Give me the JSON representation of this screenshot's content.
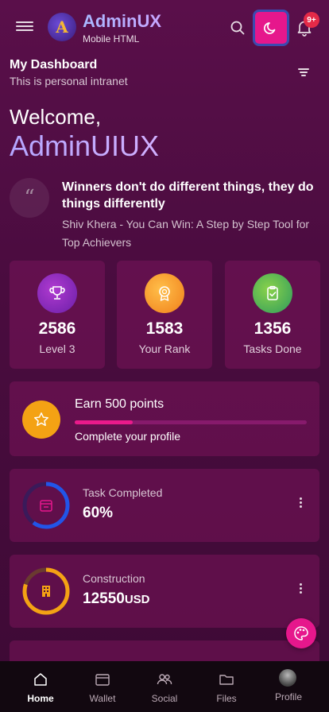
{
  "header": {
    "brand_title": "AdminUX",
    "brand_subtitle": "Mobile HTML",
    "logo_letter": "A",
    "notification_badge": "9+"
  },
  "dashboard": {
    "title": "My Dashboard",
    "subtitle": "This is personal intranet"
  },
  "welcome": {
    "greeting": "Welcome,",
    "name": "AdminUIUX"
  },
  "quote": {
    "icon_glyph": "“",
    "text": "Winners don't do different things, they do things differently",
    "author": "Shiv Khera - You Can Win: A Step by Step Tool for Top Achievers"
  },
  "stats": [
    {
      "icon": "trophy-icon",
      "value": "2586",
      "label": "Level 3",
      "color": "#8b2fc9"
    },
    {
      "icon": "medal-icon",
      "value": "1583",
      "label": "Your Rank",
      "color": "#f59a24"
    },
    {
      "icon": "clipboard-check-icon",
      "value": "1356",
      "label": "Tasks Done",
      "color": "#4caf50"
    }
  ],
  "earn": {
    "title": "Earn 500 points",
    "subtitle": "Complete your profile",
    "progress": 0.25,
    "icon": "star-icon"
  },
  "metrics": [
    {
      "label": "Task Completed",
      "value": "60%",
      "unit": "",
      "progress": 0.6,
      "color": "#2255e8",
      "icon": "calendar-icon"
    },
    {
      "label": "Construction",
      "value": "12550",
      "unit": "USD",
      "progress": 0.8,
      "color": "#f4a214",
      "icon": "building-icon"
    }
  ],
  "nav": [
    {
      "label": "Home",
      "icon": "home-icon",
      "active": true
    },
    {
      "label": "Wallet",
      "icon": "wallet-icon",
      "active": false
    },
    {
      "label": "Social",
      "icon": "people-icon",
      "active": false
    },
    {
      "label": "Files",
      "icon": "folder-icon",
      "active": false
    },
    {
      "label": "Profile",
      "icon": "avatar",
      "active": false
    }
  ],
  "colors": {
    "accent": "#e6178c",
    "background": "#4a0c3f",
    "card": "#6e1458"
  }
}
